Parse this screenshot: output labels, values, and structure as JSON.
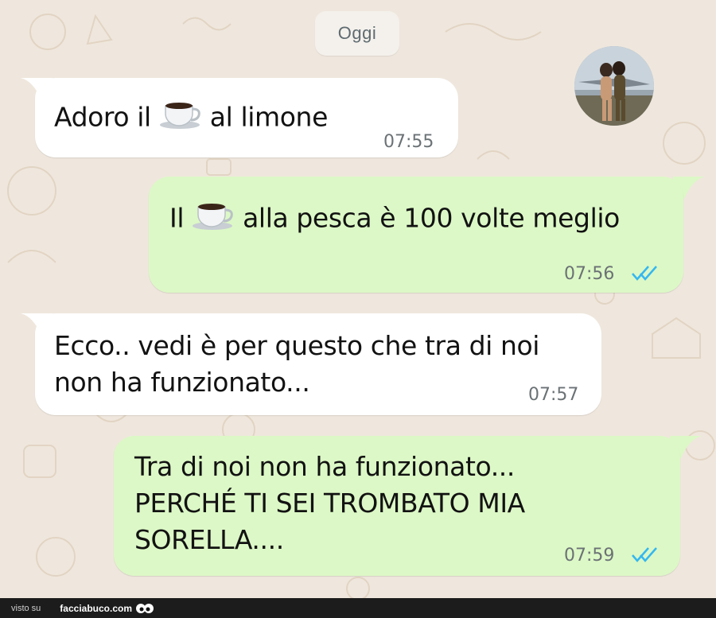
{
  "chat": {
    "date_label": "Oggi",
    "messages": [
      {
        "direction": "in",
        "text_before": "Adoro il",
        "emoji": "coffee-icon",
        "text_after": "al limone",
        "time": "07:55"
      },
      {
        "direction": "out",
        "text_before": "Il",
        "emoji": "coffee-icon",
        "text_after": "alla pesca è 100 volte meglio",
        "time": "07:56",
        "status": "read"
      },
      {
        "direction": "in",
        "line1": "Ecco.. vedi è per questo che tra di noi",
        "line2": "non ha funzionato...",
        "time": "07:57"
      },
      {
        "direction": "out",
        "line1": "Tra di noi non ha funzionato...",
        "line2": "PERCHÉ TI SEI TROMBATO MIA",
        "line3": "SORELLA....",
        "time": "07:59",
        "status": "read"
      }
    ]
  },
  "footer": {
    "visto_label": "visto su",
    "brand": "facciabuco.com"
  },
  "colors": {
    "incoming_bubble": "#ffffff",
    "outgoing_bubble": "#dcf8c6",
    "read_ticks": "#34b7f1",
    "wallpaper": "#efe7dd"
  }
}
